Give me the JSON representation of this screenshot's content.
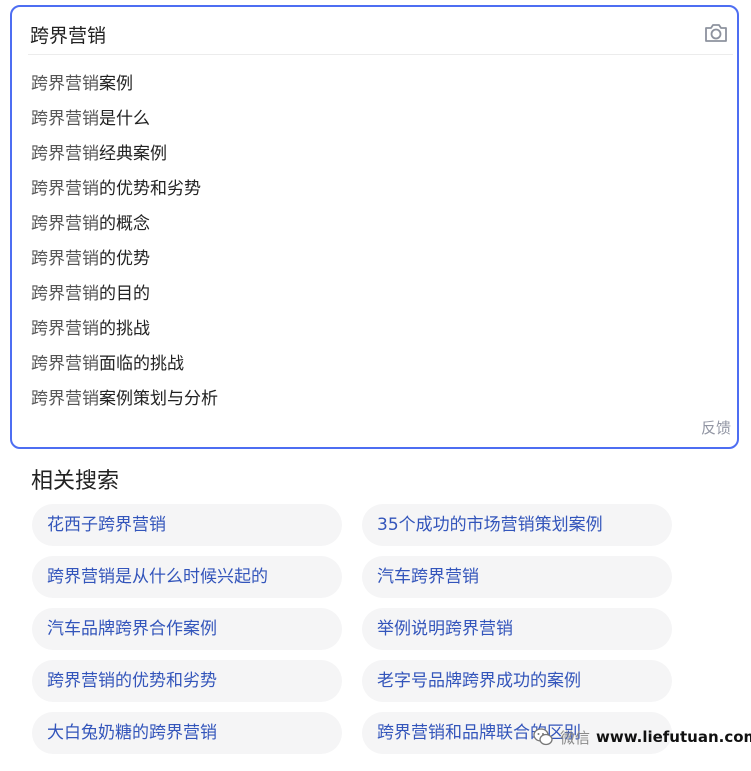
{
  "search": {
    "query": "跨界营销",
    "camera_icon": "camera-icon"
  },
  "suggestions": [
    {
      "base": "跨界营销",
      "rest": "案例"
    },
    {
      "base": "跨界营销",
      "rest": "是什么"
    },
    {
      "base": "跨界营销",
      "rest": "经典案例"
    },
    {
      "base": "跨界营销",
      "rest": "的优势和劣势"
    },
    {
      "base": "跨界营销",
      "rest": "的概念"
    },
    {
      "base": "跨界营销",
      "rest": "的优势"
    },
    {
      "base": "跨界营销",
      "rest": "的目的"
    },
    {
      "base": "跨界营销",
      "rest": "的挑战"
    },
    {
      "base": "跨界营销",
      "rest": "面临的挑战"
    },
    {
      "base": "跨界营销",
      "rest": "案例策划与分析"
    }
  ],
  "feedback_label": "反馈",
  "related": {
    "title": "相关搜索",
    "items": [
      "花西子跨界营销",
      "35个成功的市场营销策划案例",
      "跨界营销是从什么时候兴起的",
      "汽车跨界营销",
      "汽车品牌跨界合作案例",
      "举例说明跨界营销",
      "跨界营销的优势和劣势",
      "老字号品牌跨界成功的案例",
      "大白兔奶糖的跨界营销",
      "跨界营销和品牌联合的区别"
    ]
  },
  "watermark": {
    "prefix": "微信",
    "site": "www.liefutuan.com",
    "icon": "wechat-icon"
  },
  "colors": {
    "accent": "#4e6ef2",
    "link": "#3355bb",
    "chip_bg": "#f5f5f6",
    "muted": "#9195a3"
  }
}
